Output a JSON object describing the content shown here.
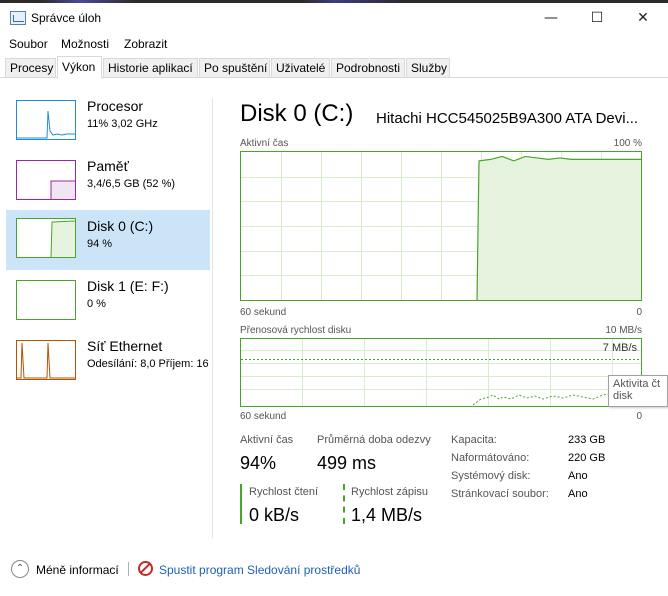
{
  "window": {
    "title": "Správce úloh",
    "minimize": "—",
    "maximize": "☐",
    "close": "✕"
  },
  "menu": {
    "file": "Soubor",
    "options": "Možnosti",
    "view": "Zobrazit"
  },
  "tabs": [
    "Procesy",
    "Výkon",
    "Historie aplikací",
    "Po spuštění",
    "Uživatelé",
    "Podrobnosti",
    "Služby"
  ],
  "active_tab": "Výkon",
  "sidebar": {
    "items": [
      {
        "name": "Procesor",
        "sub": "11% 3,02 GHz",
        "color": "#1e8ed8"
      },
      {
        "name": "Paměť",
        "sub": "3,4/6,5 GB (52 %)",
        "color": "#9928a6"
      },
      {
        "name": "Disk 0 (C:)",
        "sub": "94 %",
        "color": "#4aa42c"
      },
      {
        "name": "Disk 1 (E: F:)",
        "sub": "0 %",
        "color": "#4aa42c"
      },
      {
        "name": "Síť Ethernet",
        "sub": "Odesílání: 8,0 Příjem: 16",
        "color": "#b65300"
      }
    ]
  },
  "main": {
    "title": "Disk 0 (C:)",
    "model": "Hitachi HCC545025B9A300 ATA Devi...",
    "graph1": {
      "label": "Aktivní čas",
      "max": "100 %",
      "time": "60 sekund",
      "min": "0"
    },
    "graph2": {
      "label": "Přenosová rychlost disku",
      "max": "10 MB/s",
      "scale": "7 MB/s",
      "time": "60 sekund",
      "min": "0"
    },
    "stats": {
      "active_time_label": "Aktivní čas",
      "active_time_value": "94%",
      "response_label": "Průměrná doba odezvy",
      "response_value": "499 ms",
      "read_label": "Rychlost čtení",
      "read_value": "0 kB/s",
      "write_label": "Rychlost zápisu",
      "write_value": "1,4 MB/s"
    },
    "details": [
      {
        "label": "Kapacita:",
        "value": "233 GB"
      },
      {
        "label": "Naformátováno:",
        "value": "220 GB"
      },
      {
        "label": "Systémový disk:",
        "value": "Ano"
      },
      {
        "label": "Stránkovací soubor:",
        "value": "Ano"
      }
    ]
  },
  "tooltip": {
    "line1": "Aktivita čt",
    "line2": "disk"
  },
  "footer": {
    "fewer": "Méně informací",
    "monitor": "Spustit program Sledování prostředků"
  },
  "chart_data": {
    "type": "line",
    "active_time_percent_recent": [
      94,
      95,
      97,
      94,
      97,
      96,
      95,
      96,
      95,
      95,
      95,
      95,
      95,
      95,
      95
    ]
  }
}
